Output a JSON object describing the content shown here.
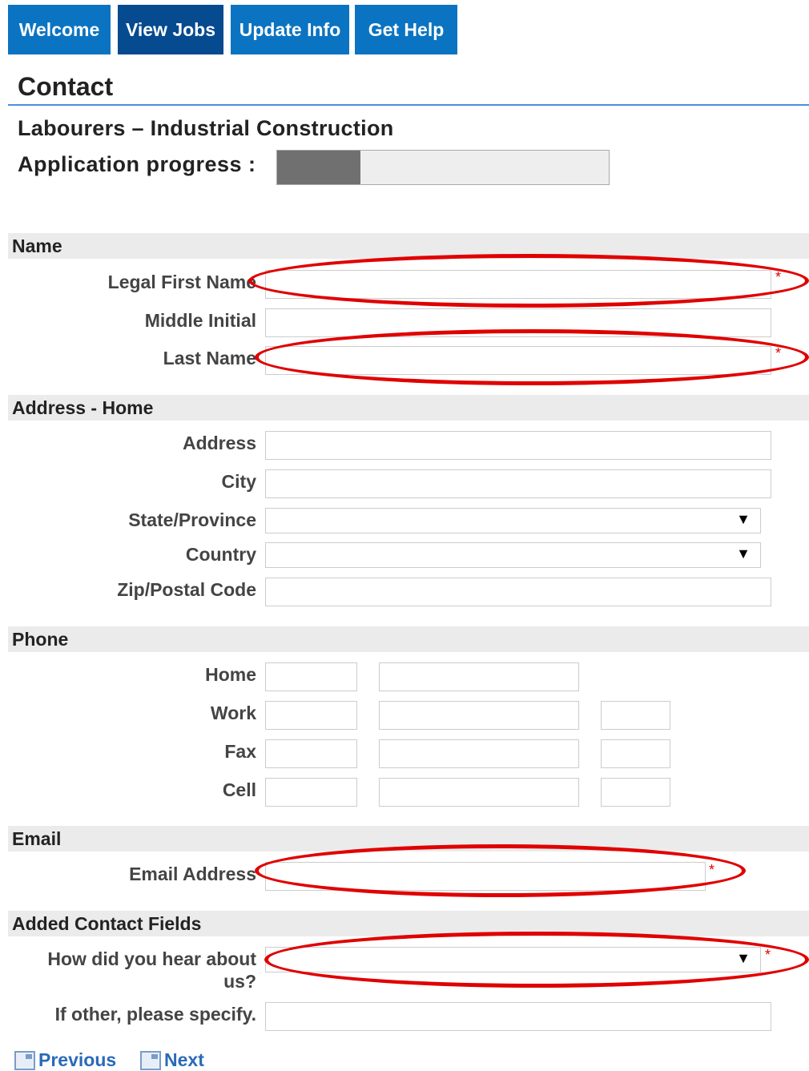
{
  "nav": {
    "tabs": [
      {
        "label": "Welcome",
        "color": "#0b74c2"
      },
      {
        "label": "View Jobs",
        "color": "#064a8f"
      },
      {
        "label": "Update Info",
        "color": "#0b74c2"
      },
      {
        "label": "Get Help",
        "color": "#0b74c2"
      }
    ]
  },
  "page": {
    "title": "Contact",
    "job_title": "Labourers – Industrial Construction",
    "progress_label": "Application progress :",
    "progress_fraction": 0.25
  },
  "sections": {
    "name": "Name",
    "address": "Address - Home",
    "phone": "Phone",
    "email": "Email",
    "added": "Added Contact Fields"
  },
  "fields": {
    "first_name": {
      "label": "Legal First Name",
      "value": "",
      "required": true
    },
    "middle_initial": {
      "label": "Middle Initial",
      "value": ""
    },
    "last_name": {
      "label": "Last Name",
      "value": "",
      "required": true
    },
    "address": {
      "label": "Address",
      "value": ""
    },
    "city": {
      "label": "City",
      "value": ""
    },
    "state": {
      "label": "State/Province",
      "value": ""
    },
    "country": {
      "label": "Country",
      "value": ""
    },
    "zip": {
      "label": "Zip/Postal Code",
      "value": ""
    },
    "phone_home": {
      "label": "Home"
    },
    "phone_work": {
      "label": "Work"
    },
    "phone_fax": {
      "label": "Fax"
    },
    "phone_cell": {
      "label": "Cell"
    },
    "email_address": {
      "label": "Email Address",
      "value": "",
      "required": true
    },
    "hear_about": {
      "label_line1": "How did you hear about",
      "label_line2": "us?",
      "value": "",
      "required": true
    },
    "other_specify": {
      "label": "If other, please specify.",
      "value": ""
    }
  },
  "required_marker": "*",
  "dropdown_arrow": "▼",
  "buttons": {
    "previous": "Previous",
    "next": "Next"
  },
  "annotation_color": "#e00000"
}
